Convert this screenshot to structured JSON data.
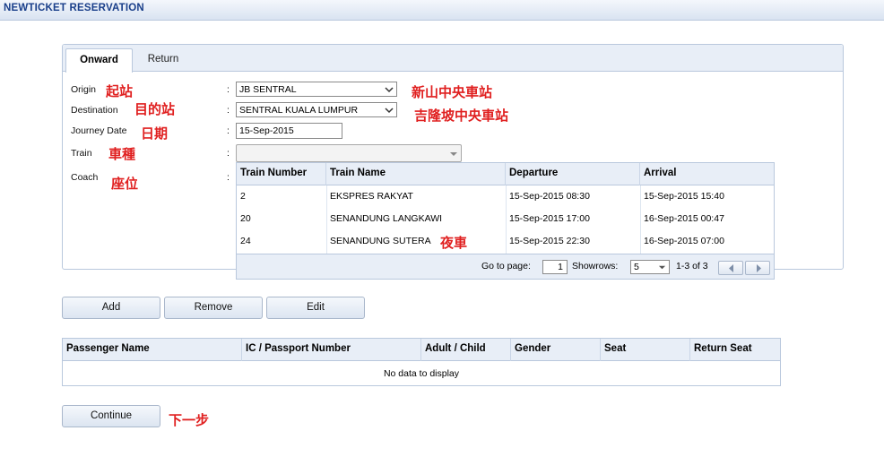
{
  "window": {
    "title": "NEWTICKET RESERVATION"
  },
  "tabs": {
    "onward": "Onward",
    "return": "Return"
  },
  "form": {
    "origin": {
      "label": "Origin",
      "value": "JB SENTRAL",
      "annotation": "起站",
      "value_annotation": "新山中央車站"
    },
    "destination": {
      "label": "Destination",
      "value": "SENTRAL KUALA LUMPUR",
      "annotation": "目的站",
      "value_annotation": "吉隆坡中央車站"
    },
    "journey_date": {
      "label": "Journey Date",
      "value": "15-Sep-2015",
      "annotation": "日期"
    },
    "train": {
      "label": "Train",
      "value": "",
      "annotation": "車種"
    },
    "coach": {
      "label": "Coach",
      "annotation": "座位"
    },
    "colon": ":"
  },
  "train_grid": {
    "columns": [
      "Train Number",
      "Train Name",
      "Departure",
      "Arrival"
    ],
    "rows": [
      {
        "number": "2",
        "name": "EKSPRES RAKYAT",
        "departure": "15-Sep-2015 08:30",
        "arrival": "15-Sep-2015 15:40"
      },
      {
        "number": "20",
        "name": "SENANDUNG LANGKAWI",
        "departure": "15-Sep-2015 17:00",
        "arrival": "16-Sep-2015 00:47"
      },
      {
        "number": "24",
        "name": "SENANDUNG SUTERA",
        "departure": "15-Sep-2015 22:30",
        "arrival": "16-Sep-2015 07:00"
      }
    ],
    "row_annotation": "夜車",
    "pager": {
      "goto_label": "Go to page:",
      "page": "1",
      "showrows_label": "Showrows:",
      "rows_per_page": "5",
      "range": "1-3 of 3"
    }
  },
  "actions": {
    "add": "Add",
    "remove": "Remove",
    "edit": "Edit"
  },
  "passenger_table": {
    "columns": [
      "Passenger Name",
      "IC / Passport Number",
      "Adult / Child",
      "Gender",
      "Seat",
      "Return Seat"
    ],
    "empty_text": "No data to display"
  },
  "continue": {
    "label": "Continue",
    "annotation": "下一步"
  },
  "colors": {
    "title": "#1a3f8a",
    "annotation": "#e02020",
    "header_bg": "#e8eef7",
    "border": "#b9c8dd"
  }
}
